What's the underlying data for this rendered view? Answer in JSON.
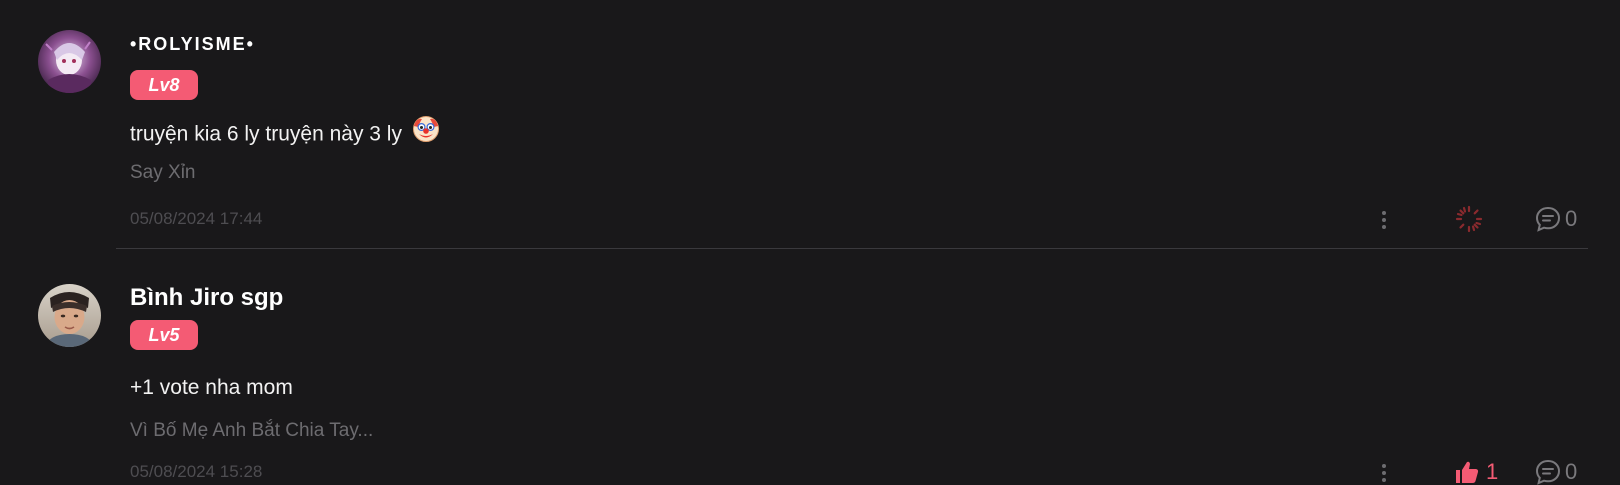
{
  "comments": [
    {
      "username": "•ROLYISME•",
      "level": "Lv8",
      "text": "truyện kia 6 ly truyện này 3 ly",
      "emoji": "clown-face-icon",
      "story_title": "Say Xỉn",
      "timestamp": "05/08/2024 17:44",
      "like_state": "loading",
      "like_count": "",
      "reply_count": "0"
    },
    {
      "username": "Bình Jiro sgp",
      "level": "Lv5",
      "text": "+1 vote nha mom",
      "story_title": "Vì Bố Mẹ Anh Bắt Chia Tay...",
      "timestamp": "05/08/2024 15:28",
      "like_state": "liked",
      "like_count": "1",
      "reply_count": "0"
    }
  ],
  "colors": {
    "background": "#19181a",
    "accent": "#f45b74",
    "muted_text": "#6d6c70",
    "timestamp": "#4e4d51",
    "divider": "#3a393d",
    "icon": "#7a797d"
  }
}
